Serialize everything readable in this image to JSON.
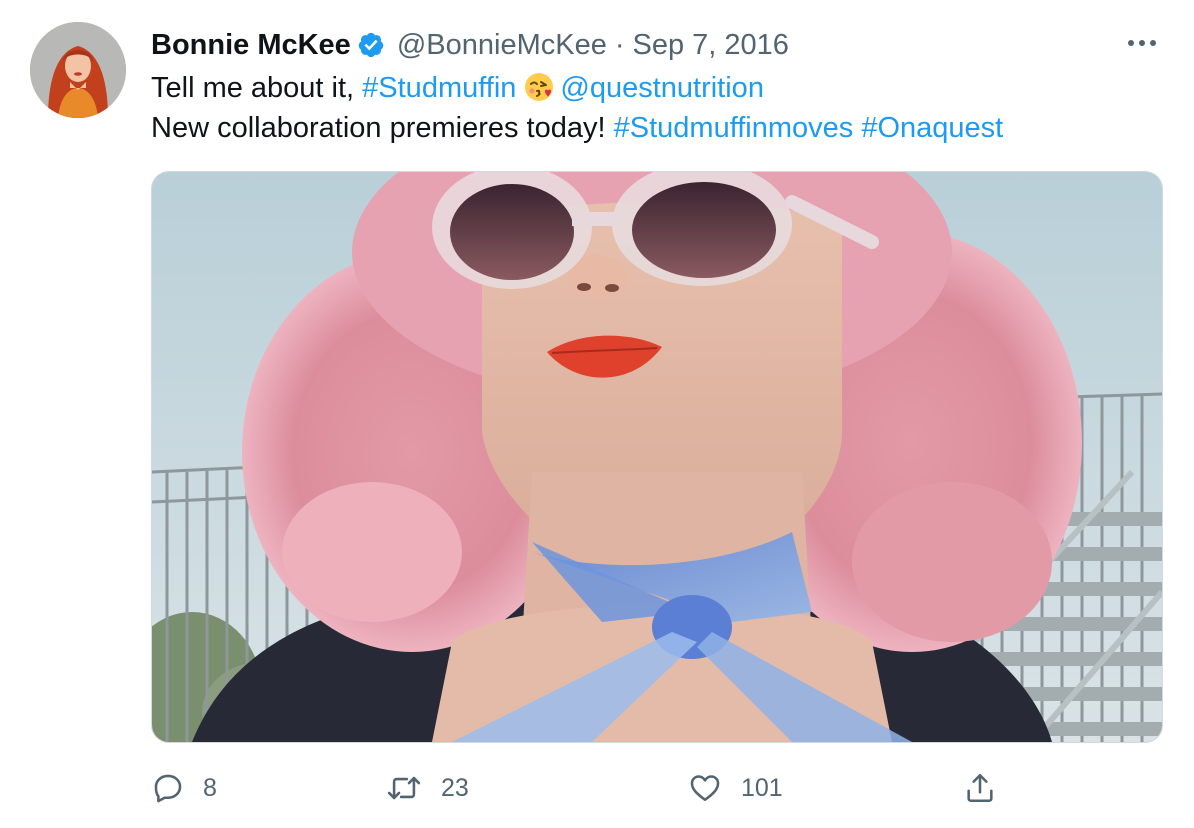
{
  "tweet": {
    "author": {
      "display_name": "Bonnie McKee",
      "handle": "@BonnieMcKee",
      "verified_icon": "verified-badge-icon"
    },
    "separator": "·",
    "date": "Sep 7, 2016",
    "more_icon": "more-options-icon",
    "text": {
      "line1_prefix": "Tell me about it, ",
      "hashtag1": "#Studmuffin",
      "emoji_icon": "face-blowing-kiss-emoji",
      "mention": "@questnutrition",
      "line2_prefix": "New collaboration premieres today! ",
      "hashtag2": "#Studmuffinmoves",
      "hashtag3": "#Onaquest"
    },
    "media": {
      "type": "photo",
      "icon": "photo-woman-pink-hair-sunglasses"
    },
    "actions": {
      "reply": {
        "icon": "reply-icon",
        "count": "8"
      },
      "retweet": {
        "icon": "retweet-icon",
        "count": "23"
      },
      "like": {
        "icon": "heart-icon",
        "count": "101"
      },
      "share": {
        "icon": "share-icon"
      }
    }
  },
  "colors": {
    "text": "#0f1419",
    "muted": "#536471",
    "link": "#1d9bf0",
    "border": "#cfd9de"
  }
}
